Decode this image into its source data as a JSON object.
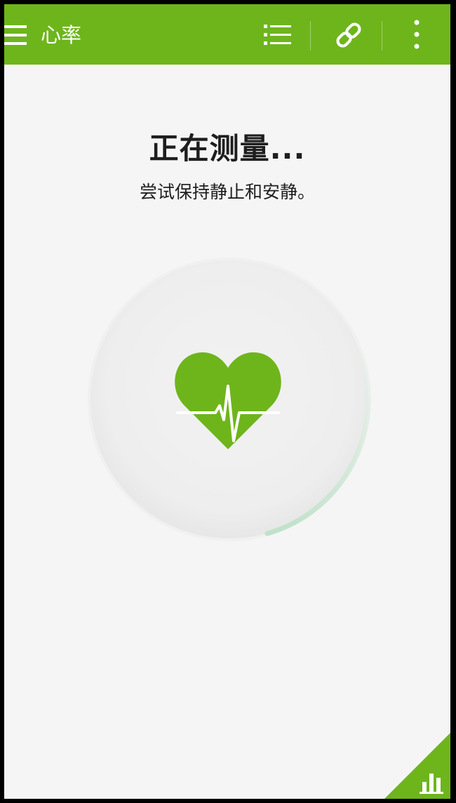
{
  "app_bar": {
    "title": "心率",
    "menu_icon": "hamburger-menu-icon",
    "list_icon": "list-icon",
    "link_icon": "link-icon",
    "more_icon": "more-vert-icon"
  },
  "status": {
    "heading": "正在测量...",
    "instruction": "尝试保持静止和安静。"
  },
  "measure": {
    "icon": "heart-pulse-icon"
  },
  "corner": {
    "icon": "bar-chart-icon"
  },
  "colors": {
    "accent": "#6eb51c",
    "background": "#f5f5f5",
    "circle": "#efefef",
    "progress": "#c6e5cf",
    "text": "#1e1e1e"
  }
}
